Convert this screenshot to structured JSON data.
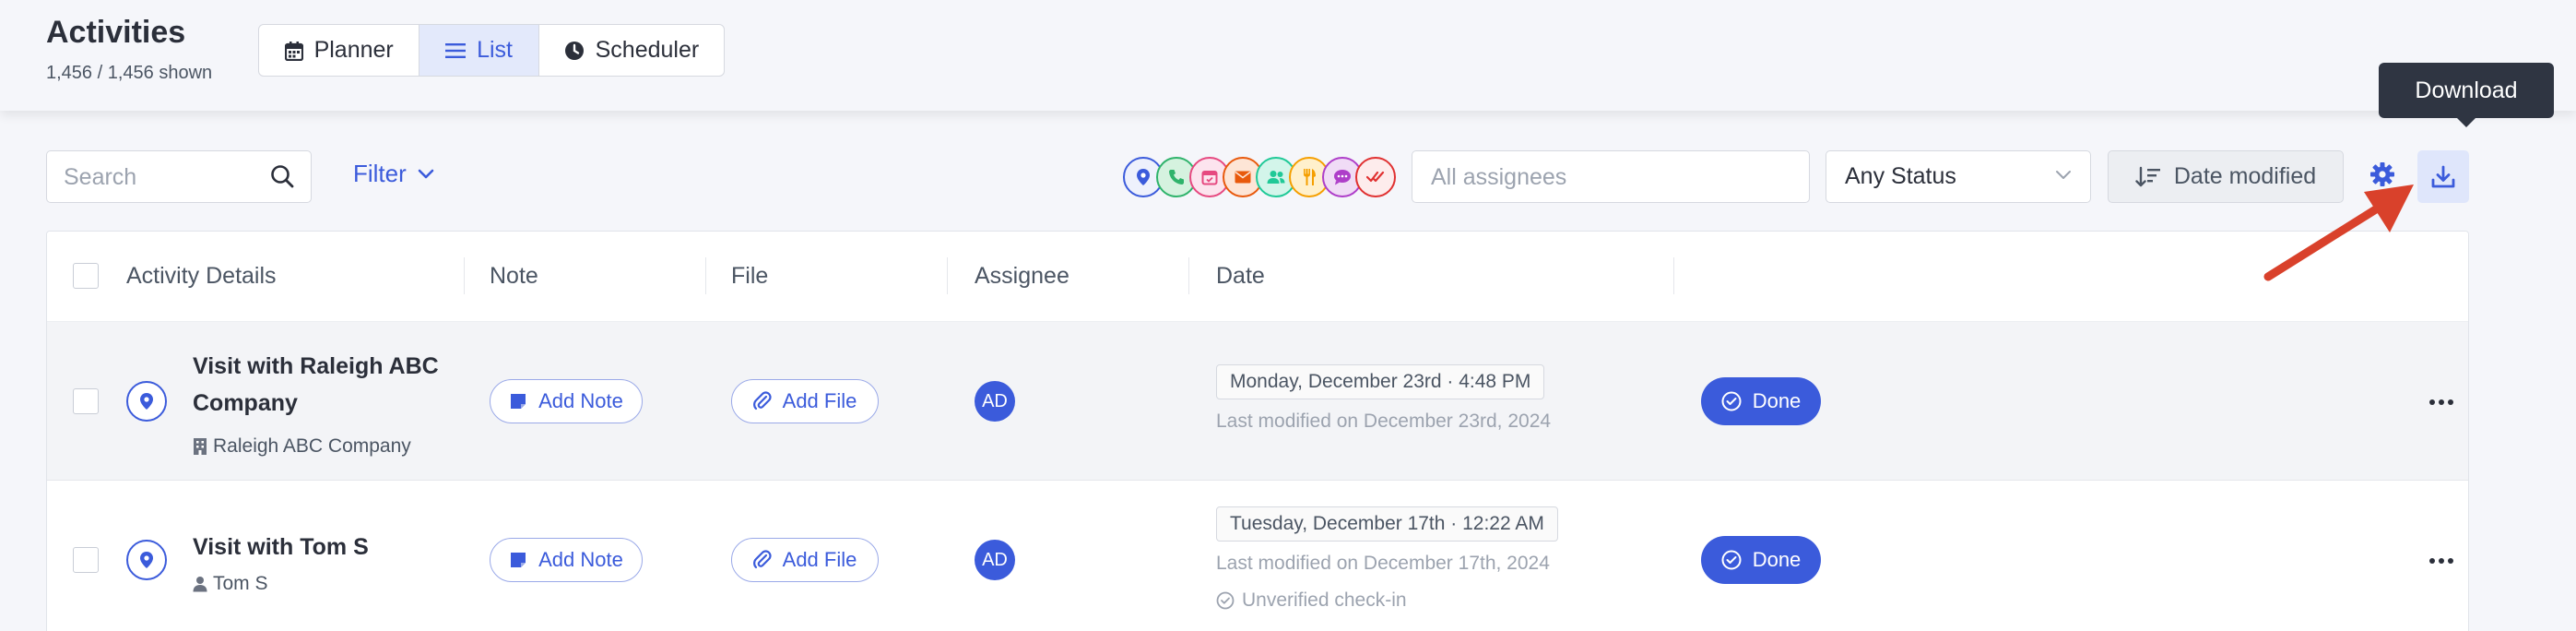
{
  "header": {
    "title": "Activities",
    "count": "1,456 / 1,456 shown",
    "views": [
      {
        "label": "Planner",
        "icon": "calendar-icon"
      },
      {
        "label": "List",
        "icon": "list-icon",
        "active": true
      },
      {
        "label": "Scheduler",
        "icon": "clock-icon"
      }
    ]
  },
  "toolbar": {
    "search_placeholder": "Search",
    "filter_label": "Filter",
    "activity_type_icons": [
      {
        "name": "location-pin-icon",
        "color": "#3b5bdb"
      },
      {
        "name": "phone-icon",
        "color": "#2fb36b"
      },
      {
        "name": "calendar-event-icon",
        "color": "#e64980"
      },
      {
        "name": "email-icon",
        "color": "#e8590c"
      },
      {
        "name": "users-icon",
        "color": "#20c997"
      },
      {
        "name": "utensils-icon",
        "color": "#f59f00"
      },
      {
        "name": "chat-icon",
        "color": "#ae3ec9"
      },
      {
        "name": "task-check-icon",
        "color": "#e03131"
      }
    ],
    "assignees_placeholder": "All assignees",
    "status_value": "Any Status",
    "sort_label": "Date modified",
    "download_tooltip": "Download"
  },
  "colors": {
    "accent": "#3b5bdb",
    "annotation_arrow": "#d9412b"
  },
  "table": {
    "columns": [
      "Activity Details",
      "Note",
      "File",
      "Assignee",
      "Date"
    ],
    "add_note_label": "Add Note",
    "add_file_label": "Add File",
    "rows": [
      {
        "title": "Visit with Raleigh ABC Company",
        "subtitle": "Raleigh ABC Company",
        "subtitle_icon": "building-icon",
        "assignee": "AD",
        "date": "Monday, December 23rd · 4:48 PM",
        "last_modified": "Last modified on December 23rd, 2024",
        "status": "Done"
      },
      {
        "title": "Visit with Tom S",
        "subtitle": "Tom S",
        "subtitle_icon": "person-icon",
        "assignee": "AD",
        "date": "Tuesday, December 17th · 12:22 AM",
        "last_modified": "Last modified on December 17th, 2024",
        "checkin": "Unverified check-in",
        "status": "Done"
      }
    ]
  }
}
